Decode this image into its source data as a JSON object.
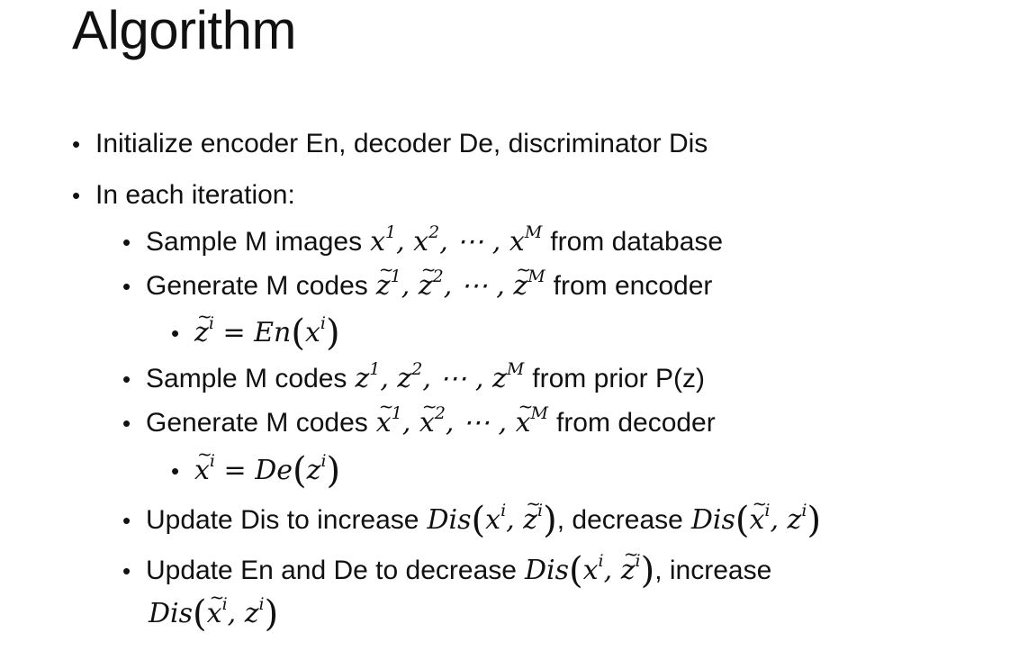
{
  "title": "Algorithm",
  "bullets": {
    "init": "Initialize encoder En, decoder De, discriminator Dis",
    "iter": "In each iteration:",
    "sample_images_a": "Sample M images",
    "sample_images_b": "from database",
    "gen_codes_enc_a": "Generate M codes",
    "gen_codes_enc_b": "from encoder",
    "sample_codes_a": "Sample M codes",
    "sample_codes_b": "from prior P(z)",
    "gen_codes_dec_a": "Generate M codes",
    "gen_codes_dec_b": "from decoder",
    "update_dis_a": "Update Dis to increase",
    "update_dis_b": ", decrease",
    "update_ende_a": "Update En and De to decrease",
    "update_ende_b": ", increase"
  }
}
